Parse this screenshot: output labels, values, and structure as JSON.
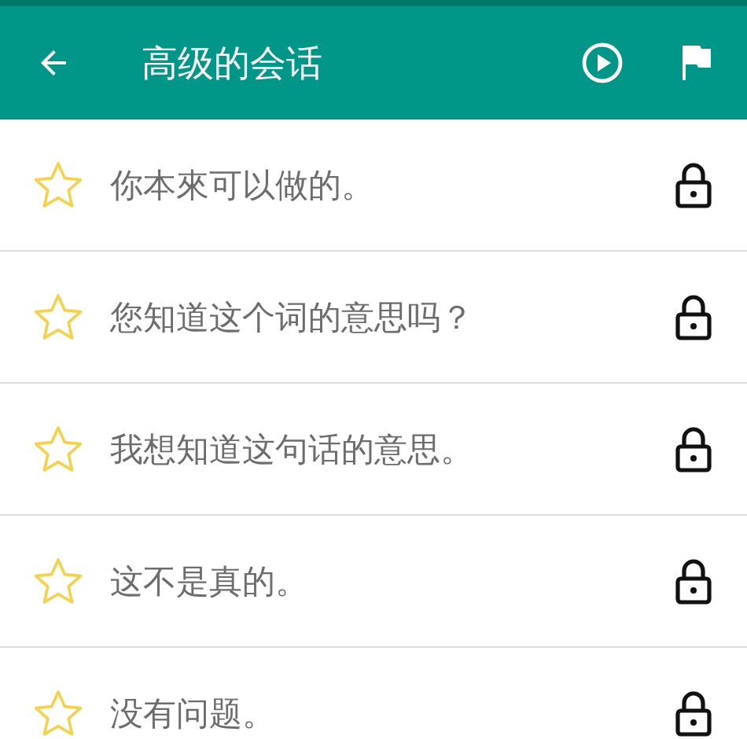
{
  "app_bar": {
    "title": "高级的会话"
  },
  "phrases": [
    {
      "text": "你本來可以做的。",
      "starred": false,
      "locked": true
    },
    {
      "text": "您知道这个词的意思吗？",
      "starred": false,
      "locked": true
    },
    {
      "text": "我想知道这句话的意思。",
      "starred": false,
      "locked": true
    },
    {
      "text": "这不是真的。",
      "starred": false,
      "locked": true
    },
    {
      "text": "没有问题。",
      "starred": false,
      "locked": true
    }
  ]
}
